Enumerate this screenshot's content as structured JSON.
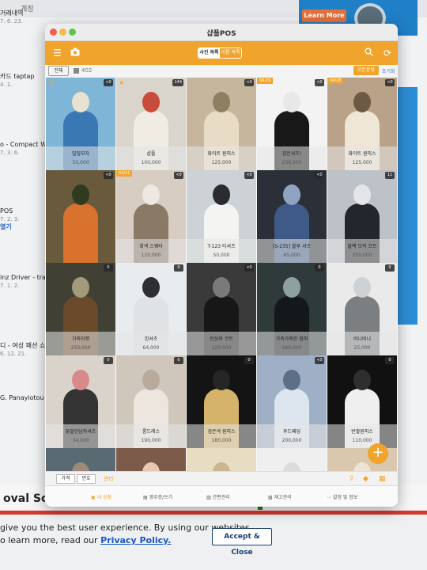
{
  "background": {
    "page_label": "계정",
    "ad_button": "Learn More",
    "left_list": [
      {
        "title": "거래내역",
        "sub": "7. 6. 23."
      },
      {
        "title": "카드 taptap",
        "sub": "4. 1."
      },
      {
        "title": "o - Compact Wi",
        "sub": "7. 3. 6."
      },
      {
        "title": "POS",
        "sub": "7. 2. 3.",
        "more": "열기"
      },
      {
        "title": "inz Driver - train",
        "sub": "7. 1. 2."
      },
      {
        "title": "디 - 여성 패션 쇼핑",
        "sub": "6. 12. 21."
      },
      {
        "title": "G. Panayiotou",
        "sub": ""
      }
    ],
    "footer_heading": "oval Solutions",
    "cookie_line1": "give you the best user experience. By using our websites,",
    "cookie_line2": "o learn more, read our",
    "privacy_link": "Privacy Policy.",
    "accept_button": "Accept & Close"
  },
  "app": {
    "title": "샵플POS",
    "mode_tabs": [
      "사진 목록",
      "이름 목록"
    ],
    "filter_all": "전체",
    "item_count": "402",
    "sort_button": "모든분류",
    "reset_link": "초기화",
    "accent": "#f0a42b",
    "products": [
      {
        "name": "밀짚모자",
        "price": "50,000",
        "badge": "<0",
        "tag": "",
        "star": true
      },
      {
        "name": "샵플",
        "price": "100,000",
        "badge": "144",
        "tag": "",
        "star": true
      },
      {
        "name": "화이트 원피스",
        "price": "125,000",
        "badge": "<0",
        "tag": "",
        "star": false
      },
      {
        "name": "검은셔츠!",
        "price": "236,500",
        "badge": "<0",
        "tag": "06/29",
        "star": false
      },
      {
        "name": "화이트 원피스",
        "price": "125,000",
        "badge": "<0",
        "tag": "04/28",
        "star": false
      },
      {
        "name": "",
        "price": "",
        "badge": "<0",
        "tag": "",
        "star": false
      },
      {
        "name": "회색 스웨터",
        "price": "120,000",
        "badge": "<0",
        "tag": "03/21",
        "star": false
      },
      {
        "name": "T-123 티셔츠",
        "price": "50,000",
        "badge": "<0",
        "tag": "",
        "star": false
      },
      {
        "name": "[S-235] 블루 셔츠",
        "price": "65,000",
        "badge": "<0",
        "tag": "",
        "star": false
      },
      {
        "name": "블랙 모직 코트",
        "price": "250,000",
        "badge": "11",
        "tag": "",
        "star": false
      },
      {
        "name": "가죽자켓",
        "price": "250,000",
        "badge": "0",
        "tag": "",
        "star": false
      },
      {
        "name": "흰셔츠",
        "price": "64,000",
        "badge": "0",
        "tag": "",
        "star": false
      },
      {
        "name": "언상파 코트",
        "price": "220,000",
        "badge": "<0",
        "tag": "",
        "star": false
      },
      {
        "name": "가죽가죽한 점퍼",
        "price": "240,000",
        "badge": "0",
        "tag": "",
        "star": false
      },
      {
        "name": "비니비니",
        "price": "25,000",
        "badge": "0",
        "tag": "",
        "star": false
      },
      {
        "name": "꽃들인남자셔츠",
        "price": "34,000",
        "badge": "0",
        "tag": "",
        "star": false
      },
      {
        "name": "롱드레스",
        "price": "190,000",
        "badge": "0",
        "tag": "",
        "star": false
      },
      {
        "name": "검은색 원피스",
        "price": "180,000",
        "badge": "0",
        "tag": "",
        "star": false
      },
      {
        "name": "후드패딩",
        "price": "200,000",
        "badge": "<0",
        "tag": "",
        "star": false
      },
      {
        "name": "반팔원피스",
        "price": "110,000",
        "badge": "0",
        "tag": "",
        "star": false
      },
      {
        "name": "",
        "price": "",
        "badge": "",
        "tag": "",
        "star": false
      },
      {
        "name": "",
        "price": "",
        "badge": "",
        "tag": "",
        "star": false
      },
      {
        "name": "",
        "price": "",
        "badge": "",
        "tag": "",
        "star": false
      },
      {
        "name": "",
        "price": "",
        "badge": "",
        "tag": "",
        "star": false
      },
      {
        "name": "",
        "price": "",
        "badge": "",
        "tag": "",
        "star": false
      }
    ],
    "bottom_tabs": [
      "가격",
      "번호"
    ],
    "manage_label": "관리",
    "nav": [
      "내 상품",
      "영수증/쓰기",
      "간편관리",
      "재고관리",
      "설정 및 정보"
    ],
    "fab": "+"
  }
}
